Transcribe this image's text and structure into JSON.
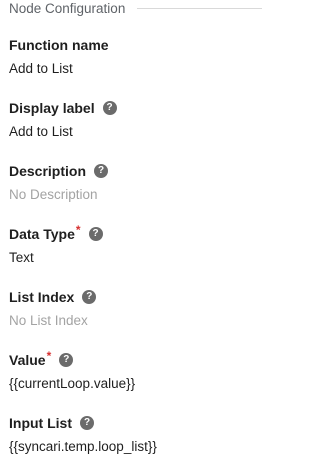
{
  "section": {
    "title": "Node Configuration"
  },
  "fields": {
    "function_name": {
      "label": "Function name",
      "value": "Add to List"
    },
    "display_label": {
      "label": "Display label",
      "help_icon": "help-icon",
      "value": "Add to List"
    },
    "description": {
      "label": "Description",
      "help_icon": "help-icon",
      "value": "No Description"
    },
    "data_type": {
      "label": "Data Type",
      "required": "*",
      "help_icon": "help-icon",
      "value": "Text"
    },
    "list_index": {
      "label": "List Index",
      "help_icon": "help-icon",
      "value": "No List Index"
    },
    "value": {
      "label": "Value",
      "required": "*",
      "help_icon": "help-icon",
      "value": "{{currentLoop.value}}"
    },
    "input_list": {
      "label": "Input List",
      "help_icon": "help-icon",
      "value": "{{syncari.temp.loop_list}}"
    }
  },
  "colors": {
    "label": "#1f1f1f",
    "placeholder": "#a3a3a3",
    "required": "#d62f2f",
    "help_icon_bg": "#6b6b6b",
    "section_title": "#5f6368",
    "rule": "#d9d9d9"
  }
}
